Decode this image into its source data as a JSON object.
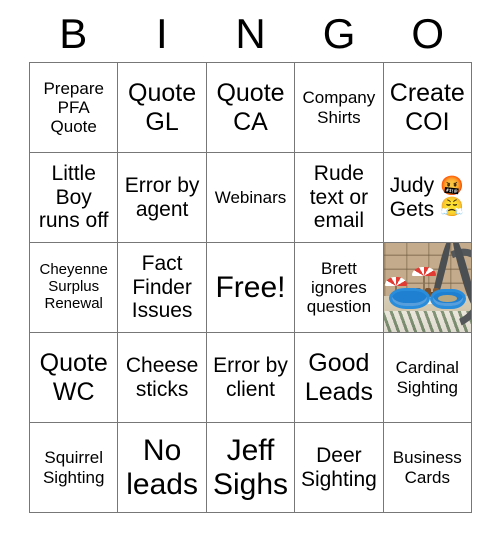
{
  "header": {
    "letters": [
      "B",
      "I",
      "N",
      "G",
      "O"
    ]
  },
  "grid": {
    "rows": 5,
    "columns": 5,
    "cells": [
      {
        "id": "b1",
        "text": "Prepare PFA Quote",
        "size": "s",
        "type": "text"
      },
      {
        "id": "i1",
        "text": "Quote GL",
        "size": "l",
        "type": "text"
      },
      {
        "id": "n1",
        "text": "Quote CA",
        "size": "l",
        "type": "text"
      },
      {
        "id": "g1",
        "text": "Company Shirts",
        "size": "s",
        "type": "text"
      },
      {
        "id": "o1",
        "text": "Create COI",
        "size": "l",
        "type": "text"
      },
      {
        "id": "b2",
        "text": "Little Boy runs off",
        "size": "m",
        "type": "text"
      },
      {
        "id": "i2",
        "text": "Error by agent",
        "size": "m",
        "type": "text"
      },
      {
        "id": "n2",
        "text": "Webinars",
        "size": "s",
        "type": "text"
      },
      {
        "id": "g2",
        "text": "Rude text or email",
        "size": "m",
        "type": "text"
      },
      {
        "id": "o2",
        "text": "Judy Gets",
        "size": "m",
        "type": "emoji",
        "emoji": "🤬😤"
      },
      {
        "id": "b3",
        "text": "Cheyenne Surplus Renewal",
        "size": "xs",
        "type": "text"
      },
      {
        "id": "i3",
        "text": "Fact Finder Issues",
        "size": "m",
        "type": "text"
      },
      {
        "id": "n3",
        "text": "Free!",
        "size": "xl",
        "type": "text"
      },
      {
        "id": "g3",
        "text": "Brett ignores question",
        "size": "s",
        "type": "text"
      },
      {
        "id": "o3",
        "text": "",
        "size": "s",
        "type": "photo",
        "photo_alt": "miniature poolside scene with red and white umbrellas and two blue kiddie pools on a rug"
      },
      {
        "id": "b4",
        "text": "Quote WC",
        "size": "l",
        "type": "text"
      },
      {
        "id": "i4",
        "text": "Cheese sticks",
        "size": "m",
        "type": "text"
      },
      {
        "id": "n4",
        "text": "Error by client",
        "size": "m",
        "type": "text"
      },
      {
        "id": "g4",
        "text": "Good Leads",
        "size": "l",
        "type": "text"
      },
      {
        "id": "o4",
        "text": "Cardinal Sighting",
        "size": "s",
        "type": "text"
      },
      {
        "id": "b5",
        "text": "Squirrel Sighting",
        "size": "s",
        "type": "text"
      },
      {
        "id": "i5",
        "text": "No leads",
        "size": "xl",
        "type": "text"
      },
      {
        "id": "n5",
        "text": "Jeff Sighs",
        "size": "xl",
        "type": "text"
      },
      {
        "id": "g5",
        "text": "Deer Sighting",
        "size": "m",
        "type": "text"
      },
      {
        "id": "o5",
        "text": "Business Cards",
        "size": "s",
        "type": "text"
      }
    ]
  },
  "colors": {
    "background": "#ffffff",
    "text": "#000000",
    "grid_line": "#777777"
  }
}
